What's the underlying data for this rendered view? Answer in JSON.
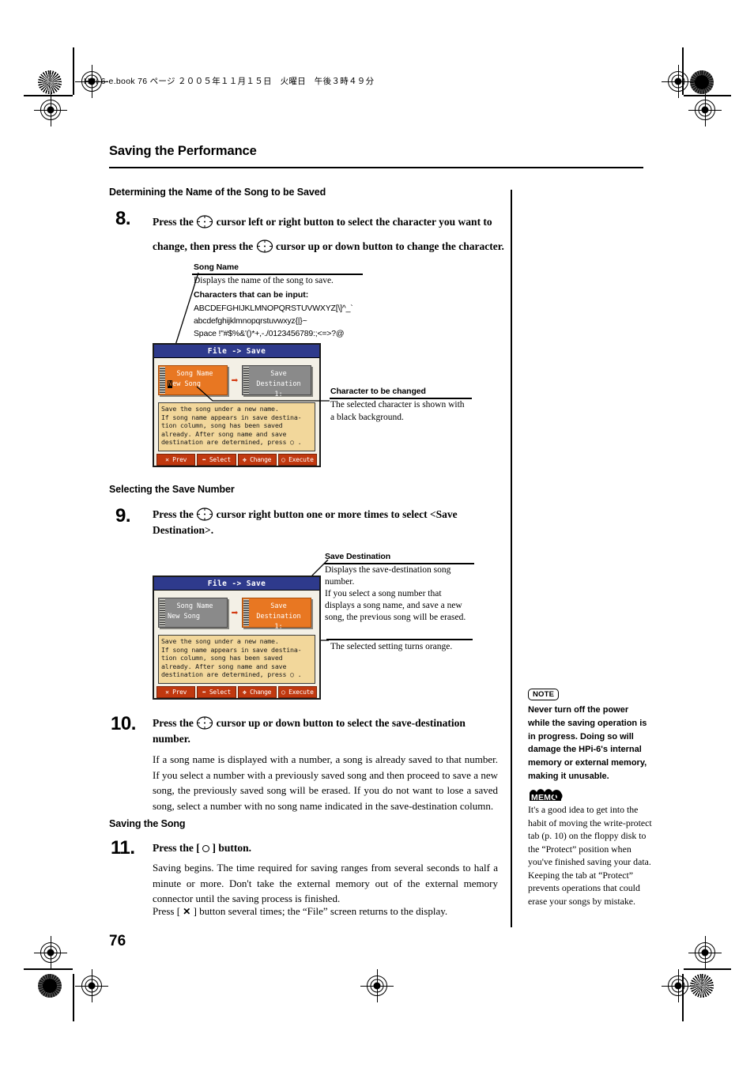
{
  "print_marks": {
    "file_info": "HPi-6-e.book  76 ページ  ２００５年１１月１５日　火曜日　午後３時４９分"
  },
  "page": {
    "title": "Saving the Performance",
    "number": "76"
  },
  "sections": [
    {
      "heading": "Determining the Name of the Song to be Saved",
      "step_number": "8.",
      "step_text_line1_a": "Press the",
      "step_text_line1_b": "cursor left or right button to select the character you want to",
      "step_text_line2_a": "change, then press the",
      "step_text_line2_b": "cursor up or down button to change the character."
    },
    {
      "heading": "Selecting the Save Number",
      "step_number": "9.",
      "step_text_a": "Press the",
      "step_text_b": "cursor right button one or more times to select <Save",
      "step_text_c": "Destination>."
    },
    {
      "heading": "Saving the Song",
      "step_number": "11.",
      "step_lead_a": "Press the [",
      "step_lead_b": "] button.",
      "body_1": "Saving begins. The time required for saving ranges from several seconds to half a minute or more. Don't take the external memory out of the external memory connector until the saving process is finished.",
      "body_2_a": "Press [",
      "body_2_b": "] button several times; the “File” screen returns to the display."
    }
  ],
  "step10": {
    "step_number": "10.",
    "lead_a": "Press the",
    "lead_b": "cursor up or down button to select the save-destination",
    "lead_c": "number.",
    "body": "If a song name is displayed with a number, a song is already saved to that number. If you select a number with a previously saved song and then proceed to save a new song, the previously saved song will be erased. If you do not want to lose a saved song, select a number with no song name indicated in the save-destination column."
  },
  "callouts": {
    "song_name": {
      "title": "Song Name",
      "desc": "Displays the name of the song to save.",
      "chars_label": "Characters that can be input:",
      "chars_line1": "ABCDEFGHIJKLMNOPQRSTUVWXYZ[\\]^_`",
      "chars_line2": "abcdefghijklmnopqrstuvwxyz{|}~",
      "chars_line3": "Space !\"#$%&'()*+,-./0123456789:;<=>?@"
    },
    "character_to_be_changed": {
      "title": "Character to be changed",
      "desc_line1": "The selected character is shown with",
      "desc_line2": "a black background."
    },
    "save_destination": {
      "title": "Save Destination",
      "desc_line1": "Displays the save-destination song",
      "desc_line2": "number.",
      "desc_line3": "If you select a song number that",
      "desc_line4": "displays a song name, and save a new",
      "desc_line5": "song, the previous song will be erased.",
      "orange_note": "The selected setting turns orange."
    }
  },
  "lcd_screen_1": {
    "title": "File  ->  Save",
    "card_left_label": "Song Name",
    "card_left_value_selected": "N",
    "card_left_value_rest": "ew Song",
    "card_left_state": "orange",
    "arrow": "➡",
    "card_right_label": "Save Destination",
    "card_right_value": "1:",
    "card_right_state": "grey",
    "message_lines": [
      "Save the song under a new name.",
      "If song name appears in save destina-",
      "tion column, song has been saved",
      "already. After song name and save",
      "destination are determined, press ○ ."
    ],
    "buttons": [
      "✕ Prev",
      "⬌ Select",
      "✥ Change",
      "○ Execute"
    ]
  },
  "lcd_screen_2": {
    "title": "File  ->  Save",
    "card_left_label": "Song Name",
    "card_left_value": "New Song",
    "card_left_state": "grey",
    "arrow": "➡",
    "card_right_label": "Save Destination",
    "card_right_value": "1:",
    "card_right_state": "orange",
    "message_lines": [
      "Save the song under a new name.",
      "If song name appears in save destina-",
      "tion column, song has been saved",
      "already. After song name and save",
      "destination are determined, press ○ ."
    ],
    "buttons": [
      "✕ Prev",
      "⬌ Select",
      "✥ Change",
      "○ Execute"
    ]
  },
  "sidebar": {
    "note_badge": "NOTE",
    "note_text": "Never turn off the power while the saving operation is in progress. Doing so will damage the HPi-6's internal memory or external memory, making it unusable.",
    "memo_badge": "MEMO",
    "memo_text": "It's a good idea to get into the habit of moving the write-protect tab (p. 10) on the floppy disk to the “Protect” position when you've finished saving your data. Keeping the tab at “Protect” prevents operations that could erase your songs by mistake."
  },
  "colors": {
    "lcd_title_bar": "#2e3a8c",
    "lcd_orange_card": "#e87722",
    "lcd_grey_card": "#8a8a8a",
    "lcd_message_bg": "#f2d79b",
    "lcd_button_bg": "#c0380f",
    "lcd_bg": "#f3f0e6"
  }
}
